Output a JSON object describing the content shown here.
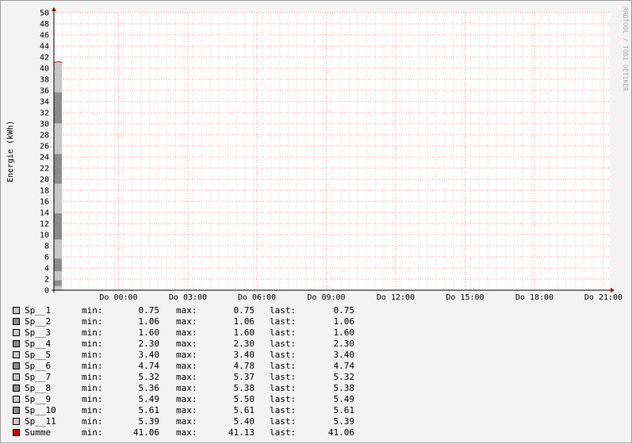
{
  "chart_data": {
    "type": "area",
    "ylabel": "Energie (kWh)",
    "ylim": [
      0,
      50
    ],
    "ytick_step": 2,
    "x_tick_labels": [
      "Do 00:00",
      "Do 03:00",
      "Do 06:00",
      "Do 09:00",
      "Do 12:00",
      "Do 15:00",
      "Do 18:00",
      "Do 21:00"
    ],
    "stacked": true,
    "series": [
      {
        "name": "Sp__1",
        "value": 0.75,
        "color": "#c8c8c8"
      },
      {
        "name": "Sp__2",
        "value": 1.06,
        "color": "#8c8c8c"
      },
      {
        "name": "Sp__3",
        "value": 1.6,
        "color": "#c8c8c8"
      },
      {
        "name": "Sp__4",
        "value": 2.3,
        "color": "#8c8c8c"
      },
      {
        "name": "Sp__5",
        "value": 3.4,
        "color": "#c8c8c8"
      },
      {
        "name": "Sp__6",
        "value": 4.74,
        "color": "#8c8c8c"
      },
      {
        "name": "Sp__7",
        "value": 5.32,
        "color": "#c8c8c8"
      },
      {
        "name": "Sp__8",
        "value": 5.38,
        "color": "#8c8c8c"
      },
      {
        "name": "Sp__9",
        "value": 5.49,
        "color": "#c8c8c8"
      },
      {
        "name": "Sp__10",
        "value": 5.61,
        "color": "#8c8c8c"
      },
      {
        "name": "Sp__11",
        "value": 5.39,
        "color": "#c8c8c8"
      }
    ],
    "total_line": {
      "name": "Summe",
      "value": 41.06,
      "color": "#cc0000"
    },
    "grid": true,
    "grid_color": "#ff9999",
    "background": "#ffffff"
  },
  "watermark": "RRDTOOL / TOBI OETIKER",
  "legend": {
    "min_label": "min:",
    "max_label": "max:",
    "last_label": "last:",
    "rows": [
      {
        "name": "Sp__1",
        "min": "0.75",
        "max": "0.75",
        "last": "0.75",
        "color": "#c8c8c8"
      },
      {
        "name": "Sp__2",
        "min": "1.06",
        "max": "1.06",
        "last": "1.06",
        "color": "#8c8c8c"
      },
      {
        "name": "Sp__3",
        "min": "1.60",
        "max": "1.60",
        "last": "1.60",
        "color": "#c8c8c8"
      },
      {
        "name": "Sp__4",
        "min": "2.30",
        "max": "2.30",
        "last": "2.30",
        "color": "#8c8c8c"
      },
      {
        "name": "Sp__5",
        "min": "3.40",
        "max": "3.40",
        "last": "3.40",
        "color": "#c8c8c8"
      },
      {
        "name": "Sp__6",
        "min": "4.74",
        "max": "4.78",
        "last": "4.74",
        "color": "#8c8c8c"
      },
      {
        "name": "Sp__7",
        "min": "5.32",
        "max": "5.37",
        "last": "5.32",
        "color": "#c8c8c8"
      },
      {
        "name": "Sp__8",
        "min": "5.36",
        "max": "5.38",
        "last": "5.38",
        "color": "#8c8c8c"
      },
      {
        "name": "Sp__9",
        "min": "5.49",
        "max": "5.50",
        "last": "5.49",
        "color": "#c8c8c8"
      },
      {
        "name": "Sp__10",
        "min": "5.61",
        "max": "5.61",
        "last": "5.61",
        "color": "#8c8c8c"
      },
      {
        "name": "Sp__11",
        "min": "5.39",
        "max": "5.40",
        "last": "5.39",
        "color": "#c8c8c8"
      },
      {
        "name": "Summe",
        "min": "41.06",
        "max": "41.13",
        "last": "41.06",
        "color": "#cc0000"
      }
    ]
  }
}
